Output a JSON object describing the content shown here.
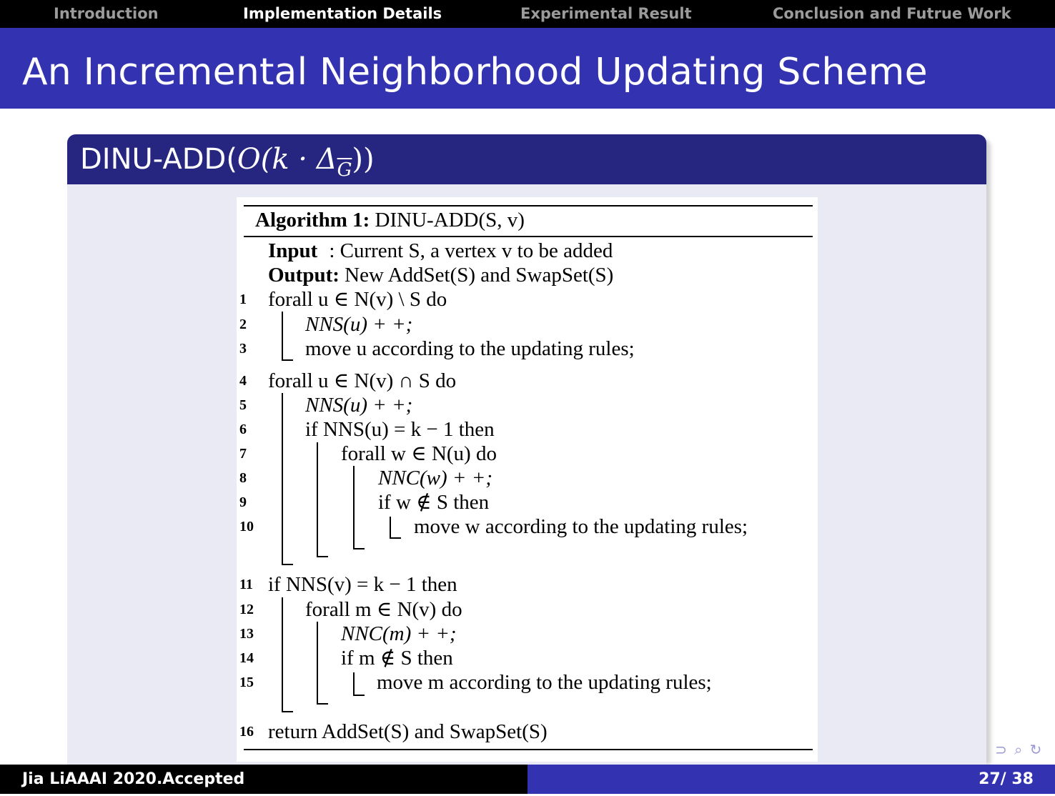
{
  "nav": {
    "items": [
      "Introduction",
      "Implementation Details",
      "Experimental Result",
      "Conclusion and Futrue Work"
    ],
    "active_index": 1
  },
  "frame": {
    "title": "An Incremental Neighborhood Updating Scheme"
  },
  "block": {
    "title_prefix": "DINU-ADD(",
    "title_math": "O(k · Δ",
    "title_sub": "G",
    "title_close": "))"
  },
  "algorithm": {
    "header_bold": "Algorithm 1:",
    "header_rest": " DINU-ADD(S, v)",
    "input_label": "Input",
    "input_text": ": Current S, a vertex v to be added",
    "output_label": "Output:",
    "output_text": " New AddSet(S) and SwapSet(S)",
    "lines": [
      {
        "n": "1",
        "text": "forall u ∈ N(v) \\ S do"
      },
      {
        "n": "2",
        "text": "NNS(u) + +;"
      },
      {
        "n": "3",
        "text": "move u according to the updating rules;"
      },
      {
        "n": "4",
        "text": "forall u ∈ N(v) ∩ S do"
      },
      {
        "n": "5",
        "text": "NNS(u) + +;"
      },
      {
        "n": "6",
        "text": "if NNS(u) = k − 1 then"
      },
      {
        "n": "7",
        "text": "forall w ∈ N(u) do"
      },
      {
        "n": "8",
        "text": "NNC(w) + +;"
      },
      {
        "n": "9",
        "text": "if w ∉ S then"
      },
      {
        "n": "10",
        "text": "move w according to the updating rules;"
      },
      {
        "n": "11",
        "text": "if NNS(v) = k − 1 then"
      },
      {
        "n": "12",
        "text": "forall m ∈ N(v) do"
      },
      {
        "n": "13",
        "text": "NNC(m) + +;"
      },
      {
        "n": "14",
        "text": "if m ∉ S then"
      },
      {
        "n": "15",
        "text": "move m according to the updating rules;"
      },
      {
        "n": "16",
        "text": "return AddSet(S) and SwapSet(S)"
      }
    ]
  },
  "footer": {
    "author": "Jia LiAAAI 2020.Accepted",
    "page": "27/ 38"
  },
  "nav_symbols": "⊃ ⌕ ↻"
}
